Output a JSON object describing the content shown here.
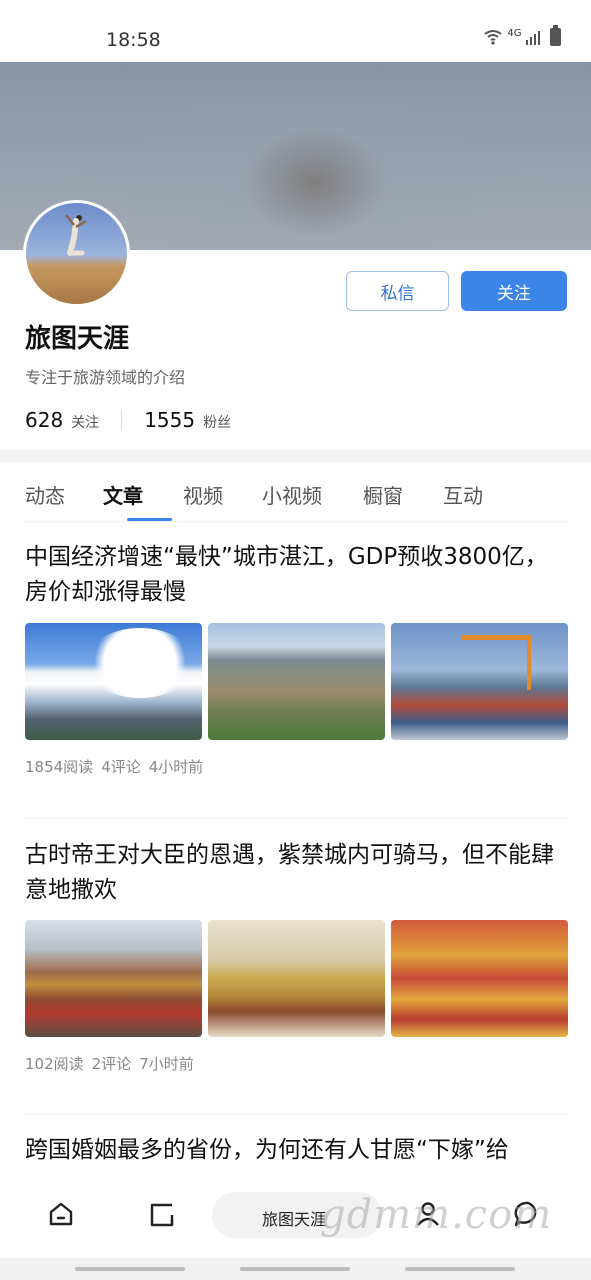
{
  "status_bar": {
    "time": "18:58",
    "network": "4G",
    "icons": [
      "wifi-icon",
      "signal-icon",
      "battery-icon"
    ]
  },
  "profile": {
    "name": "旅图天涯",
    "bio": "专注于旅游领域的介绍",
    "following_count": "628",
    "following_label": "关注",
    "followers_count": "1555",
    "followers_label": "粉丝",
    "message_button": "私信",
    "follow_button": "关注"
  },
  "tabs": [
    {
      "label": "动态"
    },
    {
      "label": "文章",
      "active": true
    },
    {
      "label": "视频"
    },
    {
      "label": "小视频"
    },
    {
      "label": "橱窗"
    },
    {
      "label": "互动"
    }
  ],
  "articles": [
    {
      "title": "中国经济增速“最快”城市湛江，GDP预收3800亿，房价却涨得最慢",
      "reads": "1854阅读",
      "comments": "4评论",
      "time": "4小时前",
      "images": [
        "city-skyline-clouds",
        "river-bridge-aerial",
        "port-cranes-containers"
      ]
    },
    {
      "title": "古时帝王对大臣的恩遇，紫禁城内可骑马，但不能肆意地撒欢",
      "reads": "102阅读",
      "comments": "2评论",
      "time": "7小时前",
      "images": [
        "forbidden-city-aerial",
        "emperor-on-horse-painting",
        "palace-roofs"
      ]
    },
    {
      "title": "跨国婚姻最多的省份，为何还有人甘愿“下嫁”给"
    }
  ],
  "bottom_nav": {
    "pill_label": "旅图天涯",
    "icons": [
      "home-icon",
      "square-icon",
      "user-icon",
      "chat-icon"
    ]
  },
  "watermark": "gdmm.com",
  "colors": {
    "accent": "#3c86ea",
    "message_border": "#9dc0e6"
  }
}
